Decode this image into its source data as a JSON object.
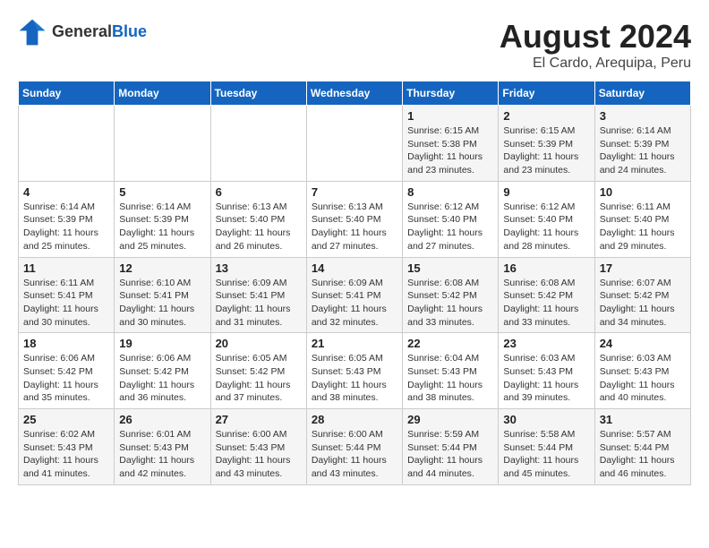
{
  "header": {
    "logo_general": "General",
    "logo_blue": "Blue",
    "title": "August 2024",
    "subtitle": "El Cardo, Arequipa, Peru"
  },
  "days_of_week": [
    "Sunday",
    "Monday",
    "Tuesday",
    "Wednesday",
    "Thursday",
    "Friday",
    "Saturday"
  ],
  "weeks": [
    [
      {
        "day": "",
        "content": ""
      },
      {
        "day": "",
        "content": ""
      },
      {
        "day": "",
        "content": ""
      },
      {
        "day": "",
        "content": ""
      },
      {
        "day": "1",
        "content": "Sunrise: 6:15 AM\nSunset: 5:38 PM\nDaylight: 11 hours\nand 23 minutes."
      },
      {
        "day": "2",
        "content": "Sunrise: 6:15 AM\nSunset: 5:39 PM\nDaylight: 11 hours\nand 23 minutes."
      },
      {
        "day": "3",
        "content": "Sunrise: 6:14 AM\nSunset: 5:39 PM\nDaylight: 11 hours\nand 24 minutes."
      }
    ],
    [
      {
        "day": "4",
        "content": "Sunrise: 6:14 AM\nSunset: 5:39 PM\nDaylight: 11 hours\nand 25 minutes."
      },
      {
        "day": "5",
        "content": "Sunrise: 6:14 AM\nSunset: 5:39 PM\nDaylight: 11 hours\nand 25 minutes."
      },
      {
        "day": "6",
        "content": "Sunrise: 6:13 AM\nSunset: 5:40 PM\nDaylight: 11 hours\nand 26 minutes."
      },
      {
        "day": "7",
        "content": "Sunrise: 6:13 AM\nSunset: 5:40 PM\nDaylight: 11 hours\nand 27 minutes."
      },
      {
        "day": "8",
        "content": "Sunrise: 6:12 AM\nSunset: 5:40 PM\nDaylight: 11 hours\nand 27 minutes."
      },
      {
        "day": "9",
        "content": "Sunrise: 6:12 AM\nSunset: 5:40 PM\nDaylight: 11 hours\nand 28 minutes."
      },
      {
        "day": "10",
        "content": "Sunrise: 6:11 AM\nSunset: 5:40 PM\nDaylight: 11 hours\nand 29 minutes."
      }
    ],
    [
      {
        "day": "11",
        "content": "Sunrise: 6:11 AM\nSunset: 5:41 PM\nDaylight: 11 hours\nand 30 minutes."
      },
      {
        "day": "12",
        "content": "Sunrise: 6:10 AM\nSunset: 5:41 PM\nDaylight: 11 hours\nand 30 minutes."
      },
      {
        "day": "13",
        "content": "Sunrise: 6:09 AM\nSunset: 5:41 PM\nDaylight: 11 hours\nand 31 minutes."
      },
      {
        "day": "14",
        "content": "Sunrise: 6:09 AM\nSunset: 5:41 PM\nDaylight: 11 hours\nand 32 minutes."
      },
      {
        "day": "15",
        "content": "Sunrise: 6:08 AM\nSunset: 5:42 PM\nDaylight: 11 hours\nand 33 minutes."
      },
      {
        "day": "16",
        "content": "Sunrise: 6:08 AM\nSunset: 5:42 PM\nDaylight: 11 hours\nand 33 minutes."
      },
      {
        "day": "17",
        "content": "Sunrise: 6:07 AM\nSunset: 5:42 PM\nDaylight: 11 hours\nand 34 minutes."
      }
    ],
    [
      {
        "day": "18",
        "content": "Sunrise: 6:06 AM\nSunset: 5:42 PM\nDaylight: 11 hours\nand 35 minutes."
      },
      {
        "day": "19",
        "content": "Sunrise: 6:06 AM\nSunset: 5:42 PM\nDaylight: 11 hours\nand 36 minutes."
      },
      {
        "day": "20",
        "content": "Sunrise: 6:05 AM\nSunset: 5:42 PM\nDaylight: 11 hours\nand 37 minutes."
      },
      {
        "day": "21",
        "content": "Sunrise: 6:05 AM\nSunset: 5:43 PM\nDaylight: 11 hours\nand 38 minutes."
      },
      {
        "day": "22",
        "content": "Sunrise: 6:04 AM\nSunset: 5:43 PM\nDaylight: 11 hours\nand 38 minutes."
      },
      {
        "day": "23",
        "content": "Sunrise: 6:03 AM\nSunset: 5:43 PM\nDaylight: 11 hours\nand 39 minutes."
      },
      {
        "day": "24",
        "content": "Sunrise: 6:03 AM\nSunset: 5:43 PM\nDaylight: 11 hours\nand 40 minutes."
      }
    ],
    [
      {
        "day": "25",
        "content": "Sunrise: 6:02 AM\nSunset: 5:43 PM\nDaylight: 11 hours\nand 41 minutes."
      },
      {
        "day": "26",
        "content": "Sunrise: 6:01 AM\nSunset: 5:43 PM\nDaylight: 11 hours\nand 42 minutes."
      },
      {
        "day": "27",
        "content": "Sunrise: 6:00 AM\nSunset: 5:43 PM\nDaylight: 11 hours\nand 43 minutes."
      },
      {
        "day": "28",
        "content": "Sunrise: 6:00 AM\nSunset: 5:44 PM\nDaylight: 11 hours\nand 43 minutes."
      },
      {
        "day": "29",
        "content": "Sunrise: 5:59 AM\nSunset: 5:44 PM\nDaylight: 11 hours\nand 44 minutes."
      },
      {
        "day": "30",
        "content": "Sunrise: 5:58 AM\nSunset: 5:44 PM\nDaylight: 11 hours\nand 45 minutes."
      },
      {
        "day": "31",
        "content": "Sunrise: 5:57 AM\nSunset: 5:44 PM\nDaylight: 11 hours\nand 46 minutes."
      }
    ]
  ]
}
